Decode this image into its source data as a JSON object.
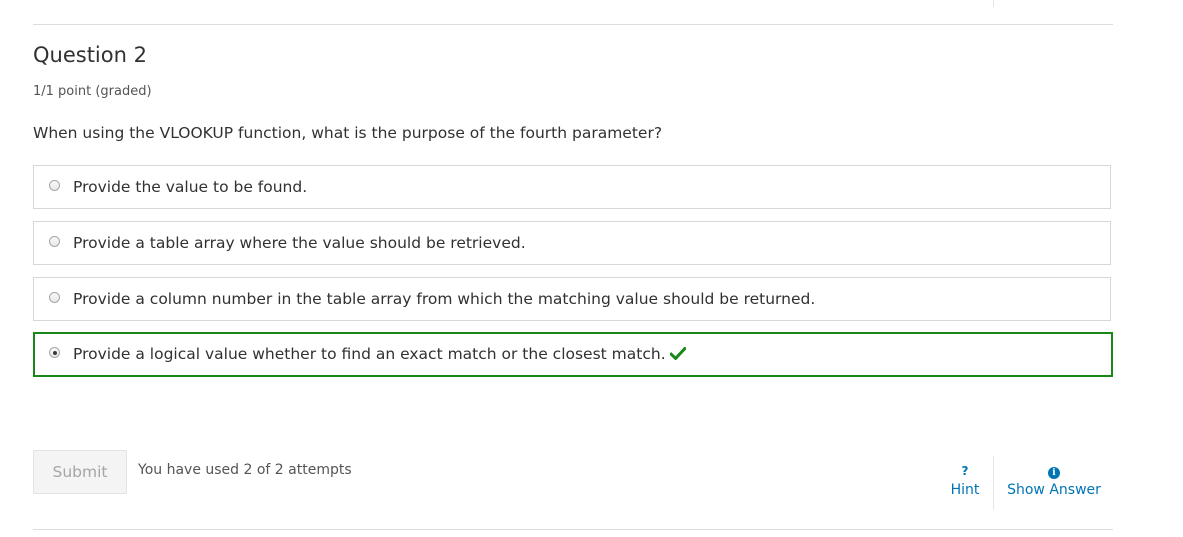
{
  "question": {
    "title": "Question 2",
    "points": "1/1 point (graded)",
    "prompt": "When using the VLOOKUP function, what is the purpose of the fourth parameter?",
    "choices": [
      {
        "label": "Provide the value to be found.",
        "selected": false,
        "correct": false
      },
      {
        "label": "Provide a table array where the value should be retrieved.",
        "selected": false,
        "correct": false
      },
      {
        "label": "Provide a column number in the table array from which the matching value should be returned.",
        "selected": false,
        "correct": false
      },
      {
        "label": "Provide a logical value whether to find an exact match or the closest match.",
        "selected": true,
        "correct": true
      }
    ]
  },
  "actions": {
    "submit_label": "Submit",
    "attempts_text": "You have used 2 of 2 attempts",
    "hint_icon": "?",
    "hint_label": "Hint",
    "show_answer_icon": "i",
    "show_answer_label": "Show Answer"
  },
  "icons": {
    "correct": "check-icon",
    "hint": "question-icon",
    "show_answer": "info-icon"
  },
  "colors": {
    "correct": "#178817",
    "link": "#0075b4",
    "text": "#313131"
  }
}
